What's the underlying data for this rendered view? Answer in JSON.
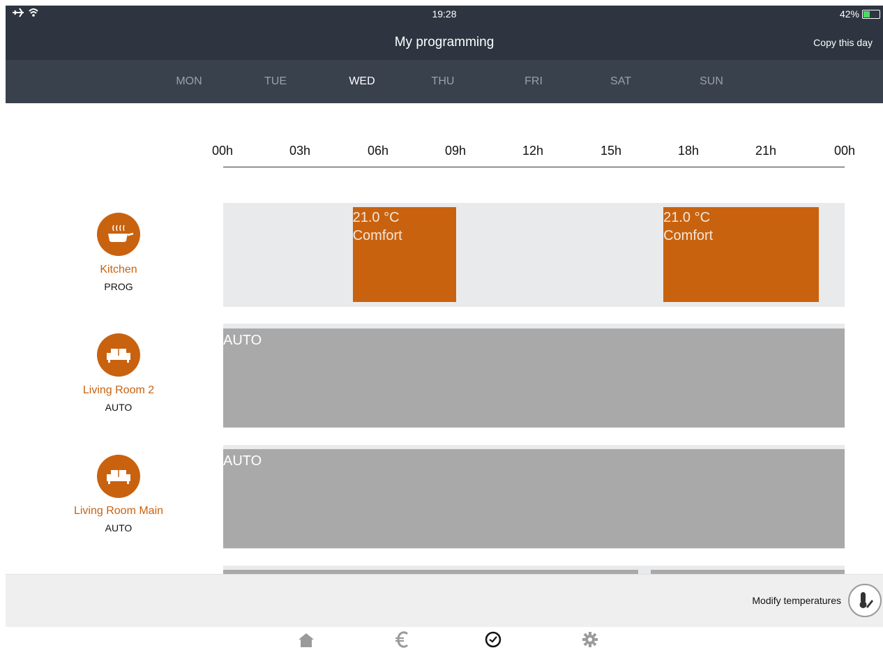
{
  "status_bar": {
    "time": "19:28",
    "battery": "42%",
    "battery_level": 0.42
  },
  "header": {
    "title": "My programming",
    "copy_day": "Copy this day"
  },
  "days": [
    {
      "label": "MON",
      "active": false
    },
    {
      "label": "TUE",
      "active": false
    },
    {
      "label": "WED",
      "active": true
    },
    {
      "label": "THU",
      "active": false
    },
    {
      "label": "FRI",
      "active": false
    },
    {
      "label": "SAT",
      "active": false
    },
    {
      "label": "SUN",
      "active": false
    }
  ],
  "hours": [
    "00h",
    "03h",
    "06h",
    "09h",
    "12h",
    "15h",
    "18h",
    "21h",
    "00h"
  ],
  "rooms": [
    {
      "name": "Kitchen",
      "mode": "PROG",
      "icon": "cooking-pot-icon",
      "blocks": [
        {
          "start_h": 5.0,
          "end_h": 9.0,
          "temp": "21.0 °C",
          "label": "Comfort"
        },
        {
          "start_h": 17.0,
          "end_h": 23.0,
          "temp": "21.0 °C",
          "label": "Comfort"
        }
      ]
    },
    {
      "name": "Living Room 2",
      "mode": "AUTO",
      "icon": "sofa-icon",
      "auto_label": "AUTO"
    },
    {
      "name": "Living Room Main",
      "mode": "AUTO",
      "icon": "sofa-icon",
      "auto_label": "AUTO"
    }
  ],
  "footer": {
    "modify": "Modify temperatures"
  },
  "tabs": [
    {
      "name": "home-icon",
      "active": false
    },
    {
      "name": "euro-icon",
      "active": false
    },
    {
      "name": "clock-icon",
      "active": true
    },
    {
      "name": "gear-icon",
      "active": false
    }
  ],
  "colors": {
    "accent": "#c9620f",
    "header": "#2e3540",
    "auto": "#a9a9a9"
  }
}
